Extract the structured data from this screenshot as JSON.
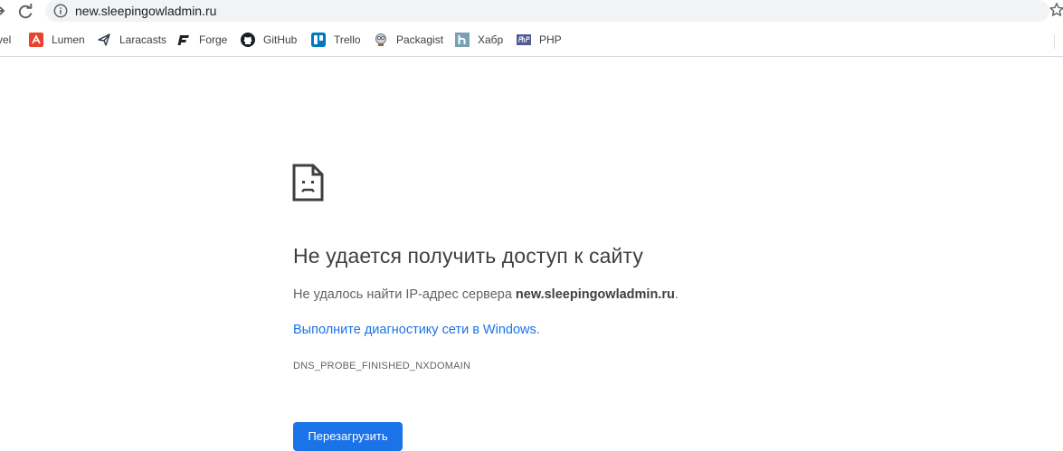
{
  "browser": {
    "url": "new.sleepingowladmin.ru"
  },
  "bookmarks": [
    {
      "label": "vel",
      "icon": "laravel-icon"
    },
    {
      "label": "Lumen",
      "icon": "lumen-icon"
    },
    {
      "label": "Laracasts",
      "icon": "laracasts-icon"
    },
    {
      "label": "Forge",
      "icon": "forge-icon"
    },
    {
      "label": "GitHub",
      "icon": "github-icon"
    },
    {
      "label": "Trello",
      "icon": "trello-icon"
    },
    {
      "label": "Packagist",
      "icon": "packagist-icon"
    },
    {
      "label": "Хабр",
      "icon": "habr-icon"
    },
    {
      "label": "PHP",
      "icon": "php-icon"
    }
  ],
  "error": {
    "title": "Не удается получить доступ к сайту",
    "desc_prefix": "Не удалось найти IP-адрес сервера ",
    "desc_host": "new.sleepingowladmin.ru",
    "desc_suffix": ".",
    "diag_link": "Выполните диагностику сети в Windows",
    "diag_dot": ".",
    "code": "DNS_PROBE_FINISHED_NXDOMAIN",
    "reload_label": "Перезагрузить"
  },
  "colors": {
    "accent": "#1a73e8",
    "lumen": "#e74430",
    "trello": "#0079bf",
    "habr": "#77a2b6",
    "php": "#4f5b93"
  }
}
